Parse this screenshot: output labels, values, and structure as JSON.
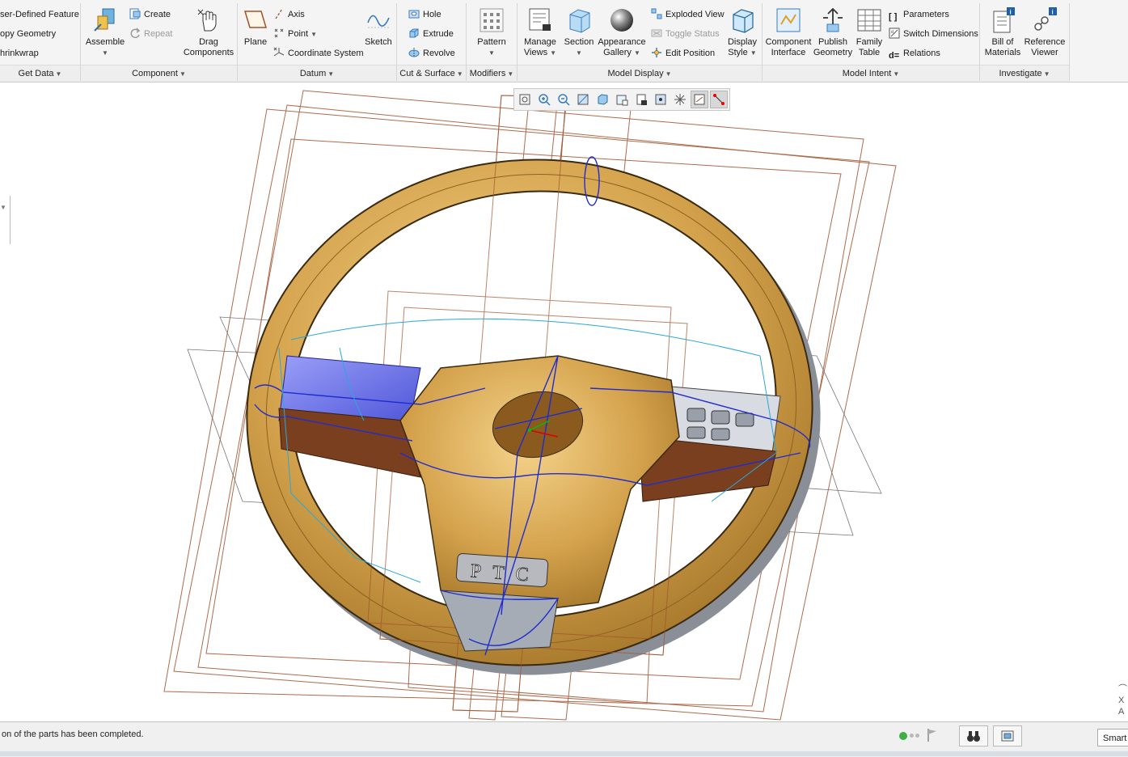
{
  "ribbon": {
    "get_data": {
      "label": "Get Data",
      "items": [
        "ser-Defined Feature",
        "opy Geometry",
        "hrinkwrap"
      ]
    },
    "component": {
      "label": "Component",
      "assemble": "Assemble",
      "create": "Create",
      "repeat": "Repeat",
      "drag_line1": "Drag",
      "drag_line2": "Components"
    },
    "datum": {
      "label": "Datum",
      "plane": "Plane",
      "axis": "Axis",
      "point": "Point",
      "coordinate_system": "Coordinate System",
      "sketch": "Sketch"
    },
    "cut_surface": {
      "label": "Cut & Surface",
      "hole": "Hole",
      "extrude": "Extrude",
      "revolve": "Revolve"
    },
    "modifiers": {
      "label": "Modifiers",
      "pattern": "Pattern"
    },
    "model_display": {
      "label": "Model Display",
      "manage_line1": "Manage",
      "manage_line2": "Views",
      "section": "Section",
      "appearance_line1": "Appearance",
      "appearance_line2": "Gallery",
      "exploded_view": "Exploded View",
      "toggle_status": "Toggle Status",
      "edit_position": "Edit Position",
      "display_line1": "Display",
      "display_line2": "Style"
    },
    "model_intent": {
      "label": "Model Intent",
      "component_line1": "Component",
      "component_line2": "Interface",
      "publish_line1": "Publish",
      "publish_line2": "Geometry",
      "family_line1": "Family",
      "family_line2": "Table",
      "parameters": "Parameters",
      "switch_dimensions": "Switch Dimensions",
      "relations": "Relations"
    },
    "investigate": {
      "label": "Investigate",
      "bom_line1": "Bill of",
      "bom_line2": "Materials",
      "ref_line1": "Reference",
      "ref_line2": "Viewer"
    }
  },
  "model": {
    "logo_text": "PTC"
  },
  "status": {
    "message": "on of the parts has been completed.",
    "smart_filter": "Smart"
  },
  "colors": {
    "wheel_gold": "#d4a24c",
    "wheel_rim_shadow": "#8a8f97",
    "datum_plane": "#a0522d",
    "edge_highlight": "#1f2ccf",
    "curve_cyan": "#2aa8d8",
    "trim_blue": "#6a6ff0",
    "trim_wood": "#7a3f1e"
  }
}
